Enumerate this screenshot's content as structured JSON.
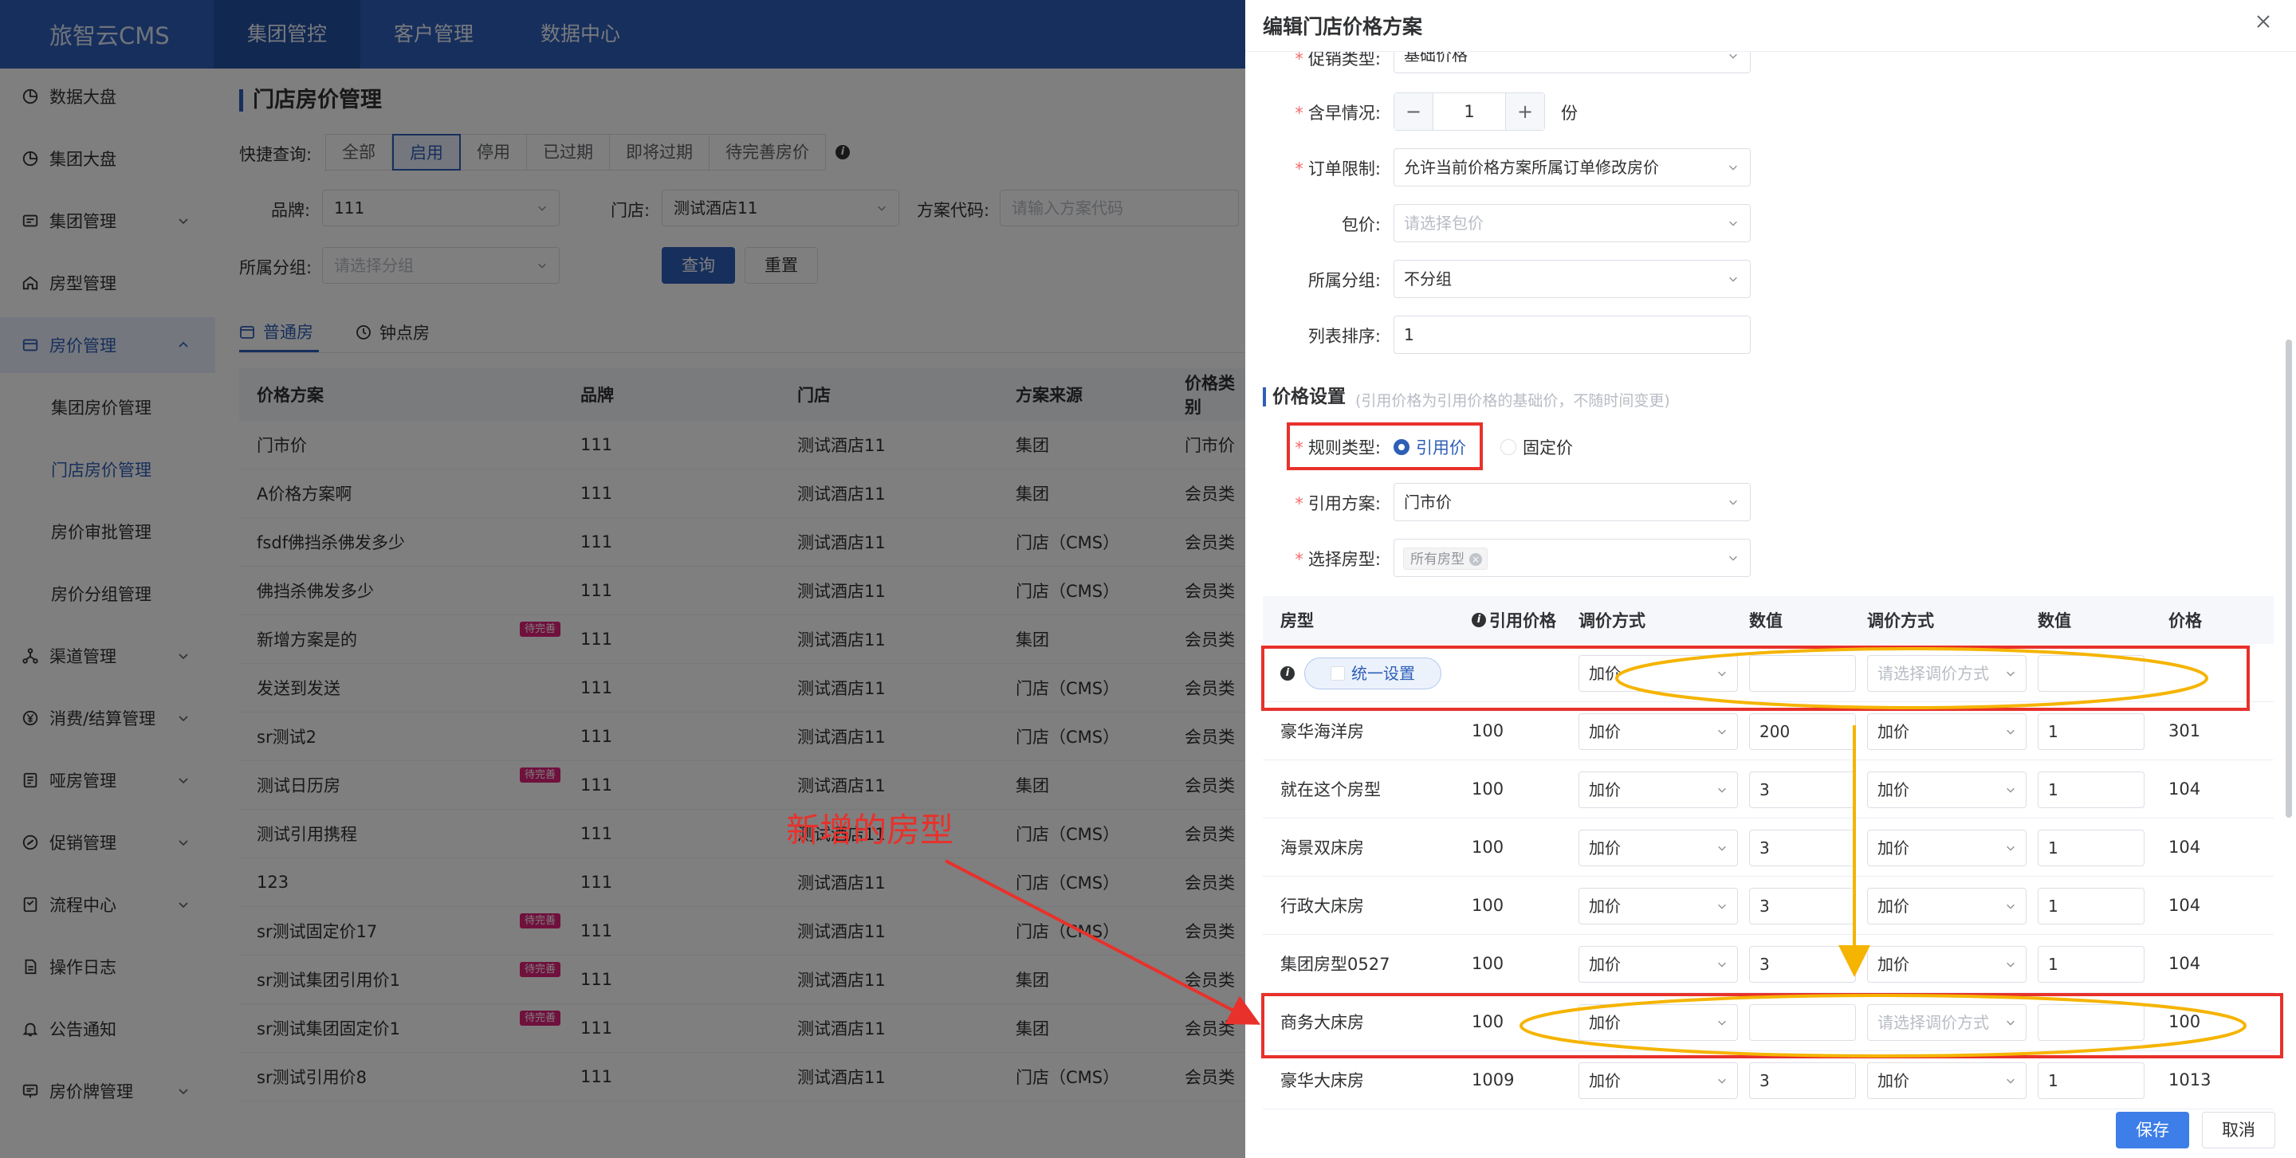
{
  "app": {
    "logo": "旅智云CMS"
  },
  "topnav": [
    "集团管控",
    "客户管理",
    "数据中心"
  ],
  "sidebar": {
    "items": [
      {
        "label": "数据大盘",
        "icon": "chart-icon"
      },
      {
        "label": "集团大盘",
        "icon": "chart-icon"
      },
      {
        "label": "集团管理",
        "icon": "building-icon"
      },
      {
        "label": "房型管理",
        "icon": "home-icon"
      },
      {
        "label": "房价管理",
        "icon": "price-icon"
      },
      {
        "label": "集团房价管理",
        "sub": true
      },
      {
        "label": "门店房价管理",
        "sub": true
      },
      {
        "label": "房价审批管理",
        "sub": true
      },
      {
        "label": "房价分组管理",
        "sub": true
      },
      {
        "label": "渠道管理",
        "icon": "channel-icon"
      },
      {
        "label": "消费/结算管理",
        "icon": "yen-icon"
      },
      {
        "label": "哑房管理",
        "icon": "doc-icon"
      },
      {
        "label": "促销管理",
        "icon": "promo-icon"
      },
      {
        "label": "流程中心",
        "icon": "flow-icon"
      },
      {
        "label": "操作日志",
        "icon": "log-icon"
      },
      {
        "label": "公告通知",
        "icon": "bell-icon"
      },
      {
        "label": "房价牌管理",
        "icon": "board-icon"
      }
    ]
  },
  "page": {
    "title": "门店房价管理",
    "quick_label": "快捷查询:",
    "quick_filters": [
      "全部",
      "启用",
      "停用",
      "已过期",
      "即将过期",
      "待完善房价"
    ],
    "filters": {
      "brand_label": "品牌:",
      "brand_value": "111",
      "store_label": "门店:",
      "store_value": "测试酒店11",
      "code_label": "方案代码:",
      "code_placeholder": "请输入方案代码",
      "group_label": "所属分组:",
      "group_placeholder": "请选择分组"
    },
    "search_btn": "查询",
    "reset_btn": "重置",
    "tabs": [
      "普通房",
      "钟点房"
    ],
    "table": {
      "headers": [
        "价格方案",
        "品牌",
        "门店",
        "方案来源",
        "价格类别"
      ],
      "pending_tag": "待完善",
      "rows": [
        {
          "name": "门市价",
          "brand": "111",
          "store": "测试酒店11",
          "source": "集团",
          "type": "门市价",
          "pending": false
        },
        {
          "name": "A价格方案啊",
          "brand": "111",
          "store": "测试酒店11",
          "source": "集团",
          "type": "会员类",
          "pending": false
        },
        {
          "name": "fsdf佛挡杀佛发多少",
          "brand": "111",
          "store": "测试酒店11",
          "source": "门店（CMS）",
          "type": "会员类",
          "pending": false
        },
        {
          "name": "佛挡杀佛发多少",
          "brand": "111",
          "store": "测试酒店11",
          "source": "门店（CMS）",
          "type": "会员类",
          "pending": false
        },
        {
          "name": "新增方案是的",
          "brand": "111",
          "store": "测试酒店11",
          "source": "集团",
          "type": "会员类",
          "pending": true
        },
        {
          "name": "发送到发送",
          "brand": "111",
          "store": "测试酒店11",
          "source": "门店（CMS）",
          "type": "会员类",
          "pending": false
        },
        {
          "name": "sr测试2",
          "brand": "111",
          "store": "测试酒店11",
          "source": "门店（CMS）",
          "type": "会员类",
          "pending": false
        },
        {
          "name": "测试日历房",
          "brand": "111",
          "store": "测试酒店11",
          "source": "集团",
          "type": "会员类",
          "pending": true
        },
        {
          "name": "测试引用携程",
          "brand": "111",
          "store": "测试酒店11",
          "source": "门店（CMS）",
          "type": "会员类",
          "pending": false
        },
        {
          "name": "123",
          "brand": "111",
          "store": "测试酒店11",
          "source": "门店（CMS）",
          "type": "会员类",
          "pending": false
        },
        {
          "name": "sr测试固定价17",
          "brand": "111",
          "store": "测试酒店11",
          "source": "门店（CMS）",
          "type": "会员类",
          "pending": true
        },
        {
          "name": "sr测试集团引用价1",
          "brand": "111",
          "store": "测试酒店11",
          "source": "集团",
          "type": "会员类",
          "pending": true
        },
        {
          "name": "sr测试集团固定价1",
          "brand": "111",
          "store": "测试酒店11",
          "source": "集团",
          "type": "会员类",
          "pending": true
        },
        {
          "name": "sr测试引用价8",
          "brand": "111",
          "store": "测试酒店11",
          "source": "门店（CMS）",
          "type": "会员类",
          "pending": false
        }
      ]
    }
  },
  "drawer": {
    "title": "编辑门店价格方案",
    "form": {
      "promo_type_label": "促销类型:",
      "promo_type_value": "基础价格",
      "breakfast_label": "含早情况:",
      "breakfast_value": "1",
      "breakfast_unit": "份",
      "order_limit_label": "订单限制:",
      "order_limit_value": "允许当前价格方案所属订单修改房价",
      "package_label": "包价:",
      "package_placeholder": "请选择包价",
      "group_label": "所属分组:",
      "group_value": "不分组",
      "sort_label": "列表排序:",
      "sort_value": "1"
    },
    "price_section": {
      "title": "价格设置",
      "note": "(引用价格为引用价格的基础价，不随时间变更)",
      "rule_label": "规则类型:",
      "rule_options": [
        "引用价",
        "固定价"
      ],
      "ref_plan_label": "引用方案:",
      "ref_plan_value": "门市价",
      "room_type_label": "选择房型:",
      "room_type_tag": "所有房型"
    },
    "room_table": {
      "headers": [
        "房型",
        "引用价格",
        "调价方式",
        "数值",
        "调价方式",
        "数值",
        "价格"
      ],
      "unified_label": "统一设置",
      "unified_row": {
        "method1": "加价",
        "value1": "",
        "method2_placeholder": "请选择调价方式",
        "value2": ""
      },
      "rows": [
        {
          "room": "豪华海洋房",
          "ref": "100",
          "m1": "加价",
          "v1": "200",
          "m2": "加价",
          "v2": "1",
          "price": "301"
        },
        {
          "room": "就在这个房型",
          "ref": "100",
          "m1": "加价",
          "v1": "3",
          "m2": "加价",
          "v2": "1",
          "price": "104"
        },
        {
          "room": "海景双床房",
          "ref": "100",
          "m1": "加价",
          "v1": "3",
          "m2": "加价",
          "v2": "1",
          "price": "104"
        },
        {
          "room": "行政大床房",
          "ref": "100",
          "m1": "加价",
          "v1": "3",
          "m2": "加价",
          "v2": "1",
          "price": "104"
        },
        {
          "room": "集团房型0527",
          "ref": "100",
          "m1": "加价",
          "v1": "3",
          "m2": "加价",
          "v2": "1",
          "price": "104"
        },
        {
          "room": "商务大床房",
          "ref": "100",
          "m1": "加价",
          "v1": "",
          "m2": "请选择调价方式",
          "v2": "",
          "price": "100",
          "m2_placeholder": true
        },
        {
          "room": "豪华大床房",
          "ref": "1009",
          "m1": "加价",
          "v1": "3",
          "m2": "加价",
          "v2": "1",
          "price": "1013"
        }
      ]
    },
    "save_btn": "保存",
    "cancel_btn": "取消"
  },
  "annotation": {
    "text": "新增的房型",
    "red": "#e8312b",
    "orange": "#f5b400"
  }
}
